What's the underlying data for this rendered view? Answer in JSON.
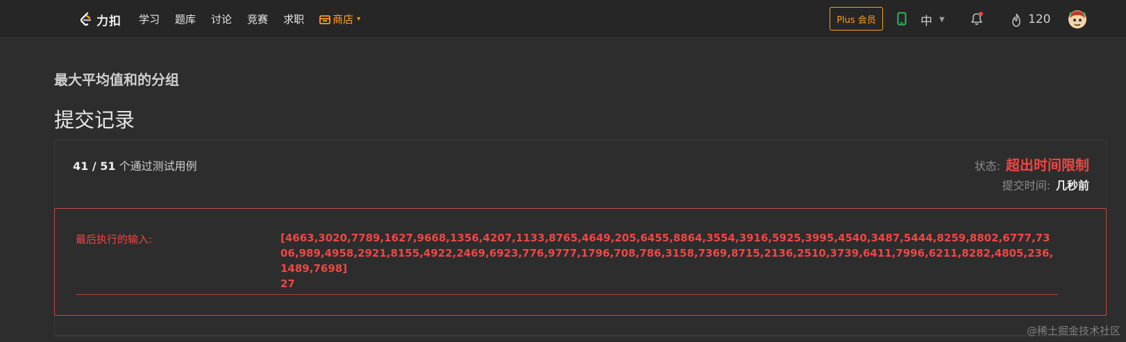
{
  "brand": {
    "name": "力扣",
    "logo_icon": "leetcode-logo-icon"
  },
  "nav": {
    "items": [
      "学习",
      "题库",
      "讨论",
      "竞赛",
      "求职"
    ],
    "shop_label": "商店",
    "accent_color": "#ffa116"
  },
  "header_right": {
    "plus_label": "Plus 会员",
    "language": "中",
    "score": "120"
  },
  "problem": {
    "title": "最大平均值和的分组"
  },
  "page": {
    "section_title": "提交记录"
  },
  "submission": {
    "passed_text": "41 / 51",
    "passed_suffix": " 个通过测试用例",
    "status_label": "状态:",
    "status_value": "超出时间限制",
    "time_label": "提交时间:",
    "time_value": "几秒前",
    "last_input_label": "最后执行的输入:",
    "last_input_line1": "[4663,3020,7789,1627,9668,1356,4207,1133,8765,4649,205,6455,8864,3554,3916,5925,3995,4540,3487,5444,8259,8802,6777,7306,989,4958,2921,8155,4922,2469,6923,776,9777,1796,708,786,3158,7369,8715,2136,2510,3739,6411,7996,6211,8282,4805,236,1489,7698]",
    "last_input_line2": "27",
    "error_color": "#ef4743"
  },
  "watermark": "@稀土掘金技术社区"
}
